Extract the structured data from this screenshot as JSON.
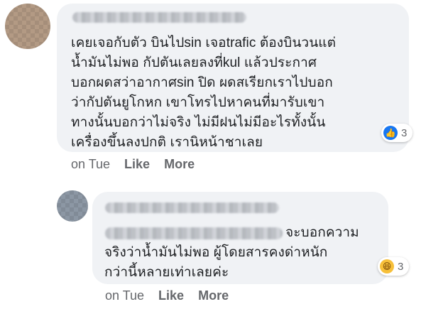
{
  "comments": [
    {
      "text": "เคยเจอกับตัว บินไปsin เจอtrafic ต้องบินวนแต่\nน้ำมันไม่พอ กัปตันเลยลงที่kul แล้วประกาศ\nบอกผดสว่าอากาศsin ปิด ผดสเรียกเราไปบอก\nว่ากัปตันยูโกหก เขาโทรไปหาคนที่มารับเขา\nทางนั้นบอกว่าไม่จริง ไม่มีฝนไม่มีอะไรทั้งนั้น\nเครื่องขึ้นลงปกติ เรานิหน้าชาเลย",
      "reaction_icon": "like-icon",
      "reaction_count": "3",
      "time": "on Tue",
      "like_label": "Like",
      "more_label": "More"
    },
    {
      "text": "จะบอกความ\nจริงว่าน้ำมันไม่พอ ผู้โดยสารคงด่าหนัก\nกว่านี้หลายเท่าเลยค่ะ",
      "reaction_icon": "haha-icon",
      "reaction_count": "3",
      "time": "on Tue",
      "like_label": "Like",
      "more_label": "More"
    }
  ]
}
